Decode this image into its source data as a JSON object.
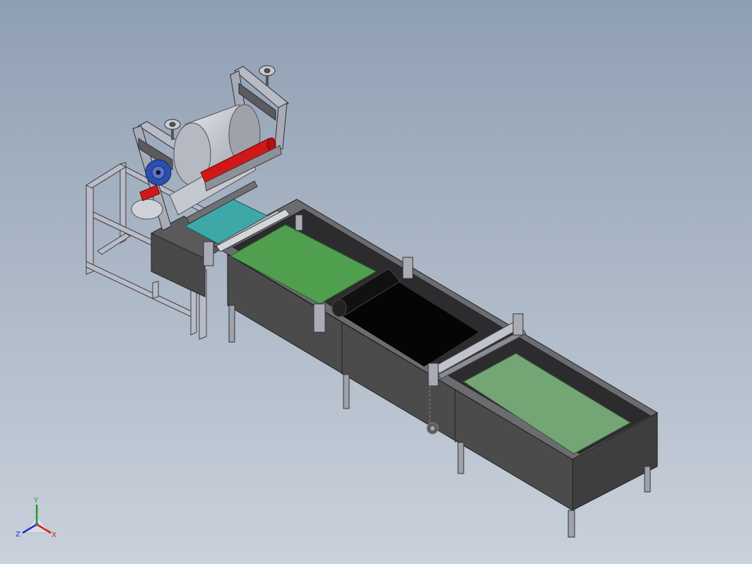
{
  "viewport": {
    "background_top": "#8f9fb3",
    "background_bottom": "#c9d1db"
  },
  "triad": {
    "x_label": "X",
    "y_label": "Y",
    "z_label": "Z",
    "x_color": "#d62020",
    "y_color": "#1f9a2a",
    "z_color": "#2030c8"
  },
  "machine": {
    "frame_color": "#b9bcc6",
    "tank_color": "#4a4a4a",
    "belt_cyan": "#3ea8a8",
    "belt_green": "#4f9f4f",
    "belt_black": "#050505",
    "belt_green_light": "#74a574",
    "roller_red": "#d01818",
    "drum_color": "#c6c8d0",
    "motor_blue": "#2a4fb0"
  }
}
